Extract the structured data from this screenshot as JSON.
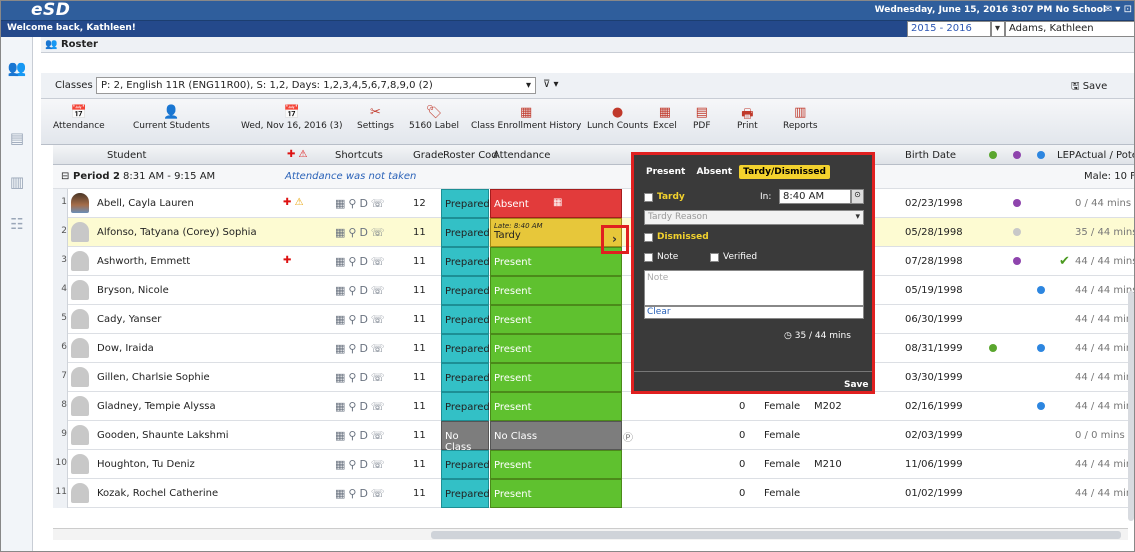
{
  "app": {
    "logo": "eSD",
    "date_status": "Wednesday, June 15, 2016  3:07 PM  No School",
    "welcome": "Welcome back, Kathleen!",
    "year": "2015 - 2016",
    "user": "Adams, Kathleen"
  },
  "roster": {
    "title": "Roster",
    "classes_label": "Classes",
    "class_value": "P: 2, English 11R (ENG11R00), S: 1,2, Days: 1,2,3,4,5,6,7,8,9,0 (2)",
    "save": "Save"
  },
  "toolbar": [
    {
      "label": "Attendance",
      "icon": "calendar-icon"
    },
    {
      "label": "Current Students",
      "icon": "students-icon"
    },
    {
      "label": "Wed, Nov 16, 2016 (3)",
      "icon": "calendar-icon"
    },
    {
      "label": "Settings",
      "icon": "tools-icon"
    },
    {
      "label": "5160 Label",
      "icon": "label-icon"
    },
    {
      "label": "Class Enrollment History",
      "icon": "history-icon"
    },
    {
      "label": "Lunch Counts",
      "icon": "lunch-icon"
    },
    {
      "label": "Excel",
      "icon": "excel-icon"
    },
    {
      "label": "PDF",
      "icon": "pdf-icon"
    },
    {
      "label": "Print",
      "icon": "print-icon"
    },
    {
      "label": "Reports",
      "icon": "reports-icon"
    }
  ],
  "columns": {
    "student": "Student",
    "shortcuts": "Shortcuts",
    "grade": "Grade",
    "roster_code": "Roster Cod",
    "attendance": "Attendance",
    "birth": "Birth Date",
    "lep": "LEP",
    "actual": "Actual / Poter"
  },
  "period": {
    "label": "Period 2",
    "time": "8:31 AM - 9:15 AM",
    "note": "Attendance was not taken",
    "male": "Male: 10 Fe"
  },
  "students": [
    {
      "n": "1",
      "name": "Abell, Cayla Lauren",
      "grade": "12",
      "roster": "Prepared",
      "att": "Absent",
      "gender": "",
      "room": "",
      "birth": "02/23/1998",
      "mins": "0 / 44 mins"
    },
    {
      "n": "2",
      "name": "Alfonso, Tatyana (Corey) Sophia",
      "grade": "11",
      "roster": "Prepared",
      "att": "Tardy",
      "late": "Late: 8:40 AM",
      "gender": "",
      "room": "",
      "birth": "05/28/1998",
      "mins": "35 / 44 mins"
    },
    {
      "n": "3",
      "name": "Ashworth, Emmett",
      "grade": "11",
      "roster": "Prepared",
      "att": "Present",
      "gender": "",
      "room": "",
      "birth": "07/28/1998",
      "mins": "44 / 44 mins"
    },
    {
      "n": "4",
      "name": "Bryson, Nicole",
      "grade": "11",
      "roster": "Prepared",
      "att": "Present",
      "gender": "",
      "room": "",
      "birth": "05/19/1998",
      "mins": "44 / 44 mins"
    },
    {
      "n": "5",
      "name": "Cady, Yanser",
      "grade": "11",
      "roster": "Prepared",
      "att": "Present",
      "gender": "",
      "room": "",
      "birth": "06/30/1999",
      "mins": "44 / 44 mins"
    },
    {
      "n": "6",
      "name": "Dow, Iraida",
      "grade": "11",
      "roster": "Prepared",
      "att": "Present",
      "gender": "",
      "room": "",
      "birth": "08/31/1999",
      "mins": "44 / 44 mins"
    },
    {
      "n": "7",
      "name": "Gillen, Charlsie Sophie",
      "grade": "11",
      "roster": "Prepared",
      "att": "Present",
      "gender": "",
      "room": "",
      "birth": "03/30/1999",
      "mins": "44 / 44 mins"
    },
    {
      "n": "8",
      "name": "Gladney, Tempie Alyssa",
      "grade": "11",
      "roster": "Prepared",
      "att": "Present",
      "zero": "0",
      "gender": "Female",
      "room": "M202",
      "birth": "02/16/1999",
      "mins": "44 / 44 mins"
    },
    {
      "n": "9",
      "name": "Gooden, Shaunte Lakshmi",
      "grade": "11",
      "roster": "No Class",
      "att": "No Class",
      "zero": "0",
      "gender": "Female",
      "room": "",
      "birth": "02/03/1999",
      "mins": "0 / 0 mins"
    },
    {
      "n": "10",
      "name": "Houghton, Tu Deniz",
      "grade": "11",
      "roster": "Prepared",
      "att": "Present",
      "zero": "0",
      "gender": "Female",
      "room": "M210",
      "birth": "11/06/1999",
      "mins": "44 / 44 mins"
    },
    {
      "n": "11",
      "name": "Kozak, Rochel Catherine",
      "grade": "11",
      "roster": "Prepared",
      "att": "Present",
      "zero": "0",
      "gender": "Female",
      "room": "",
      "birth": "01/02/1999",
      "mins": "44 / 44 mins"
    }
  ],
  "popup": {
    "tabs": [
      "Present",
      "Absent",
      "Tardy/Dismissed"
    ],
    "tardy": "Tardy",
    "in_label": "In:",
    "in_time": "8:40 AM",
    "tardy_reason": "Tardy Reason",
    "dismissed": "Dismissed",
    "note_label": "Note",
    "verified": "Verified",
    "note_placeholder": "Note",
    "clear": "Clear",
    "mins": "35 / 44 mins",
    "save": "Save"
  }
}
